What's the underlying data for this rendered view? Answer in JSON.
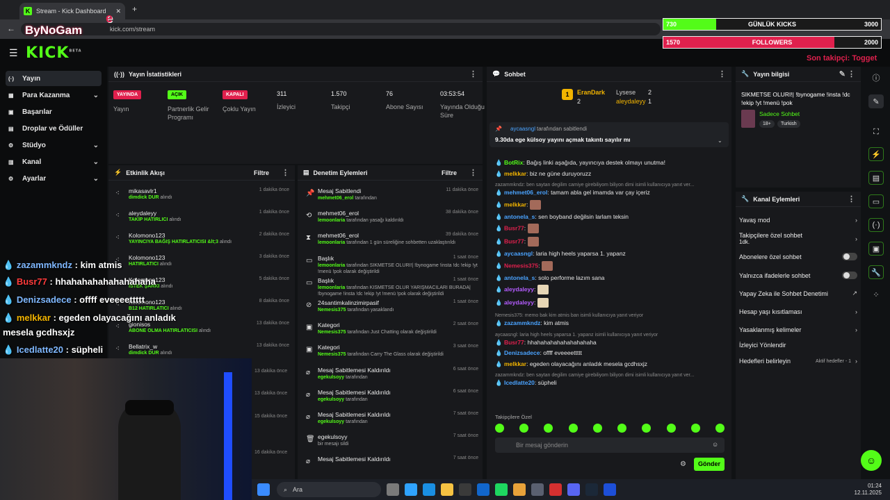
{
  "browser": {
    "tab_title": "Stream - Kick Dashboard",
    "url": "kick.com/stream"
  },
  "overlay": {
    "logo_text": "ByNoGam",
    "kicks": {
      "label": "GÜNLÜK KICKS",
      "current": "730",
      "goal": "3000",
      "progress": 0.243
    },
    "followers": {
      "label": "FOLLOWERS",
      "current": "1570",
      "goal": "2000",
      "progress": 0.785
    },
    "last_follower": "Son takipçi: Togget"
  },
  "kick": {
    "logo": "KICK",
    "beta": "BETA"
  },
  "nav": [
    {
      "label": "Yayın",
      "icon": "(·)",
      "active": true
    },
    {
      "label": "Para Kazanma",
      "icon": "▦",
      "chev": true
    },
    {
      "label": "Başarılar",
      "icon": "▣"
    },
    {
      "label": "Droplar ve Ödüller",
      "icon": "▤"
    },
    {
      "label": "Stüdyo",
      "icon": "⚙",
      "chev": true
    },
    {
      "label": "Kanal",
      "icon": "▥",
      "chev": true
    },
    {
      "label": "Ayarlar",
      "icon": "⚙",
      "chev": true
    }
  ],
  "stats": {
    "title": "Yayın İstatistikleri",
    "items": [
      {
        "badge": "YAYINDA",
        "badge_color": "#e0204d",
        "label": "Yayın"
      },
      {
        "badge": "AÇIK",
        "badge_color": "#53fc18",
        "label": "Partnerlik Gelir Programı"
      },
      {
        "badge": "KAPALI",
        "badge_color": "#e0204d",
        "label": "Çoklu Yayın"
      },
      {
        "value": "311",
        "label": "İzleyici"
      },
      {
        "value": "1.570",
        "label": "Takipçi"
      },
      {
        "value": "76",
        "label": "Abone Sayısı"
      },
      {
        "value": "03:53:54",
        "label": "Yayında Olduğu Süre"
      }
    ]
  },
  "activity": {
    "title": "Etkinlik Akışı",
    "filter": "Filtre",
    "items": [
      {
        "name": "mikasavlr1",
        "detail": "dimdick DUR",
        "suffix": "alındı",
        "time": "1 dakika önce"
      },
      {
        "name": "aleydaleyy",
        "detail": "TAKİP HATIRLICI",
        "suffix": "alındı",
        "time": "1 dakika önce"
      },
      {
        "name": "Kolomono123",
        "detail": "YAYINCIYA BAĞIŞ HATIRLATICISI &lt;3",
        "suffix": "alındı",
        "time": "2 dakika önce"
      },
      {
        "name": "Kolomono123",
        "detail": "HATIRLATICI",
        "suffix": "alındı",
        "time": "3 dakika önce"
      },
      {
        "name": "Kolomono123",
        "detail": "İSTEK ŞARKI",
        "suffix": "alındı",
        "time": "5 dakika önce"
      },
      {
        "name": "Kolomono123",
        "detail": "B12 HATIRLATICI",
        "suffix": "alındı",
        "time": "8 dakika önce"
      },
      {
        "name": "gionisos",
        "detail": "ABONE OLMA HATIRLATICISI",
        "suffix": "alındı",
        "time": "13 dakika önce"
      },
      {
        "name": "Bellatrix_w",
        "detail": "dimdick DUR",
        "suffix": "alındı",
        "time": "13 dakika önce"
      }
    ],
    "extra_times": [
      "13 dakika önce",
      "13 dakika önce",
      "15 dakika önce",
      "16 dakika önce"
    ]
  },
  "moderation": {
    "title": "Denetim Eylemleri",
    "filter": "Filtre",
    "items": [
      {
        "icon": "📌",
        "title": "Mesaj Sabitlendi",
        "user": "mehmet06_erol",
        "rest": "tarafından",
        "time": "11 dakika önce"
      },
      {
        "icon": "⟲",
        "title": "mehmet06_erol",
        "user": "lemoonlaria",
        "rest": "tarafından yasağı kaldırıldı",
        "time": "38 dakika önce"
      },
      {
        "icon": "⧗",
        "title": "mehmet06_erol",
        "user": "lemoonlaria",
        "rest": "tarafından 1 gün süreliğine sohbetten uzaklaştırıldı",
        "time": "39 dakika önce"
      },
      {
        "icon": "▭",
        "title": "Başlık",
        "user": "lemoonlaria",
        "rest": "tarafından SIKMETSE OLURI!| !bynogame !insta !dc !ekip !yt !menü !pok olarak değiştirildi",
        "time": "1 saat önce"
      },
      {
        "icon": "▭",
        "title": "Başlık",
        "user": "lemoonlaria",
        "rest": "tarafından KISMETSE OLUR YARIŞMACILARI BURADA| !bynogame !insta !dc !ekip !yt !menü !pok olarak değiştirildi",
        "time": "1 saat önce"
      },
      {
        "icon": "⊘",
        "title": "24santimkalinzimirpasif",
        "user": "Nemesis375",
        "rest": "tarafından yasaklandı",
        "time": "1 saat önce"
      },
      {
        "icon": "▣",
        "title": "Kategori",
        "user": "Nemesis375",
        "rest": "tarafından Just Chatting olarak değiştirildi",
        "time": "2 saat önce"
      },
      {
        "icon": "▣",
        "title": "Kategori",
        "user": "Nemesis375",
        "rest": "tarafından Carry The Glass olarak değiştirildi",
        "time": "3 saat önce"
      },
      {
        "icon": "⌀",
        "title": "Mesaj Sabitlemesi Kaldırıldı",
        "user": "egekulsoyy",
        "rest": "tarafından",
        "time": "6 saat önce"
      },
      {
        "icon": "⌀",
        "title": "Mesaj Sabitlemesi Kaldırıldı",
        "user": "egekulsoyy",
        "rest": "tarafından",
        "time": "6 saat önce"
      },
      {
        "icon": "⌀",
        "title": "Mesaj Sabitlemesi Kaldırıldı",
        "user": "egekulsoyy",
        "rest": "tarafından",
        "time": "7 saat önce"
      },
      {
        "icon": "🗑",
        "title": "egekulsoyy",
        "user": "",
        "rest": "bir mesajı sildi",
        "time": "7 saat önce"
      },
      {
        "icon": "⌀",
        "title": "Mesaj Sabitlemesi Kaldırıldı",
        "user": "",
        "rest": "",
        "time": "7 saat önce"
      }
    ]
  },
  "chat": {
    "title": "Sohbet",
    "top": [
      {
        "name": "EranDark",
        "count": "2"
      },
      {
        "name": "Lysese",
        "count": "2"
      },
      {
        "name": "aleydaleyy",
        "count": "1"
      }
    ],
    "pinned_by": "aycaasngl",
    "pinned_suffix": "tarafından sabitlendi",
    "pinned_msg": "9.30da ege külsoy yayını açmak takıntı sayılır mı",
    "messages": [
      {
        "user": "BotRix",
        "color": "#53fc18",
        "text": "Bağış linki aşağıda, yayıncıya destek olmayı unutma!"
      },
      {
        "user": "melkkar",
        "color": "#f2b400",
        "text": "biz ne güne duruyoruzz"
      },
      {
        "sys": "zazammkndz: ben saytan degilim camiye girebiliyom biliyon dimi isimli kullanıcıya yanıt ver..."
      },
      {
        "user": "mehmet06_erol",
        "color": "#4aa3ff",
        "text": "tamam abla gel imamda var çay içeriz"
      },
      {
        "user": "melkkar",
        "color": "#f2b400",
        "emote": true
      },
      {
        "user": "antonela_s",
        "color": "#4aa3ff",
        "text": "sen boyband değilsin larlam teksin"
      },
      {
        "user": "Busr77",
        "color": "#e0204d",
        "emote": true
      },
      {
        "user": "Busr77",
        "color": "#e0204d",
        "emote": true
      },
      {
        "user": "aycaasngl",
        "color": "#4aa3ff",
        "text": "laria high heels yaparsa 1. yapanz"
      },
      {
        "user": "Nemesis375",
        "color": "#e0204d",
        "emote": true
      },
      {
        "user": "antonela_s",
        "color": "#4aa3ff",
        "text": "solo performe lazım sana"
      },
      {
        "user": "aleydaleyy",
        "color": "#b45cff",
        "emote2": true
      },
      {
        "user": "aleydaleyy",
        "color": "#b45cff",
        "emote2": true
      },
      {
        "sys": "Nemesis375: memo bak kim atmis ban isimli kullanıcıya yanıt veriyor"
      },
      {
        "user": "zazammkndz",
        "color": "#4aa3ff",
        "text": "kim atmis"
      },
      {
        "sys": "aycaasngl: laria high heels yaparsa 1. yapanz isimli kullanıcıya yanıt veriyor"
      },
      {
        "user": "Busr77",
        "color": "#e0204d",
        "text": "hhahahahahahahahahaha"
      },
      {
        "user": "Denizsadece",
        "color": "#4aa3ff",
        "text": "offff eveeeettttt"
      },
      {
        "user": "melkkar",
        "color": "#f2b400",
        "text": "egeden olayacağını anladık mesela gcdhsxjz"
      },
      {
        "sys": "zazammkndz: ben saytan degilim camiye girebiliyom biliyon dimi isimli kullanıcıya yanıt ver..."
      },
      {
        "user": "Icedlatte20",
        "color": "#4aa3ff",
        "text": "süpheli"
      }
    ],
    "followers_only": "Takipçilere Özel",
    "placeholder": "Bir mesaj gönderin",
    "send": "Gönder"
  },
  "stream_info": {
    "title": "Yayın bilgisi",
    "stream_title": "SIKMETSE OLURI!| !bynogame !insta !dc !ekip !yt !menü !pok",
    "category": "Sadece Sohbet",
    "tags": [
      "18+",
      "Turkish"
    ]
  },
  "channel_actions": {
    "title": "Kanal Eylemleri",
    "items": [
      {
        "label": "Yavaş mod",
        "kind": "chev"
      },
      {
        "label": "Takipçilere özel sohbet",
        "sub": "1dk.",
        "kind": "chev"
      },
      {
        "label": "Abonelere özel sohbet",
        "kind": "toggle"
      },
      {
        "label": "Yalnızca ifadelerle sohbet",
        "kind": "toggle"
      },
      {
        "label": "Yapay Zeka ile Sohbet Denetimi",
        "kind": "ext"
      },
      {
        "label": "Hesap yaşı kısıtlaması",
        "kind": "chev"
      },
      {
        "label": "Yasaklanmış kelimeler",
        "kind": "chev"
      },
      {
        "label": "İzleyici Yönlendir",
        "kind": "none"
      },
      {
        "label": "Hedefleri belirleyin",
        "extra": "Aktif hedefler - 1",
        "kind": "chev"
      }
    ]
  },
  "overlay_chat": [
    {
      "user": "zazammkndz",
      "color": "#7fb8ff",
      "text": " : kim atmis"
    },
    {
      "user": "Busr77",
      "color": "#ff3b3b",
      "text": " : hhahahahahahahahaha"
    },
    {
      "user": "Denizsadece",
      "color": "#7fb8ff",
      "text": " : offff eveeeettttt"
    },
    {
      "user": "melkkar",
      "color": "#f2b400",
      "text": " : egeden olayacağını anladık"
    },
    {
      "user": "",
      "color": "#fff",
      "text": "mesela gcdhsxjz"
    },
    {
      "user": "Icedlatte20",
      "color": "#7fb8ff",
      "text": " : süpheli"
    }
  ],
  "taskbar": {
    "search": "Ara",
    "time": "01:24",
    "date": "12.11.2025"
  }
}
